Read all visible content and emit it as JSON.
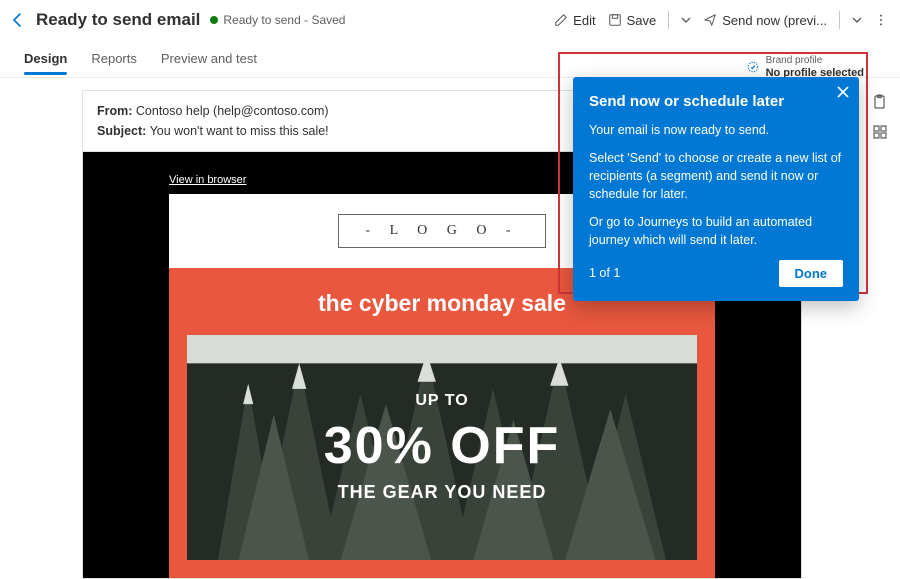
{
  "header": {
    "title": "Ready to send email",
    "status": "Ready to send - Saved",
    "edit": "Edit",
    "save": "Save",
    "send_now": "Send now (previ..."
  },
  "tabs": {
    "design": "Design",
    "reports": "Reports",
    "preview": "Preview and test"
  },
  "brand": {
    "label": "Brand profile",
    "value": "No profile selected"
  },
  "meta": {
    "from_label": "From:",
    "from_value": "Contoso help (help@contoso.com)",
    "subject_label": "Subject:",
    "subject_value": "You won't want to miss this sale!"
  },
  "email": {
    "view_in_browser": "View in browser",
    "logo": "- L O G O -",
    "hero_title": "the cyber monday sale",
    "up_to": "UP TO",
    "percent": "30% OFF",
    "gear_line": "THE GEAR YOU NEED"
  },
  "tip": {
    "title": "Send now or schedule later",
    "line1": "Your email is now ready to send.",
    "line2": "Select 'Send' to choose or create a new list of recipients (a segment) and send it now or schedule for later.",
    "line3": "Or go to Journeys to build an automated journey which will send it later.",
    "progress": "1 of 1",
    "done": "Done"
  }
}
